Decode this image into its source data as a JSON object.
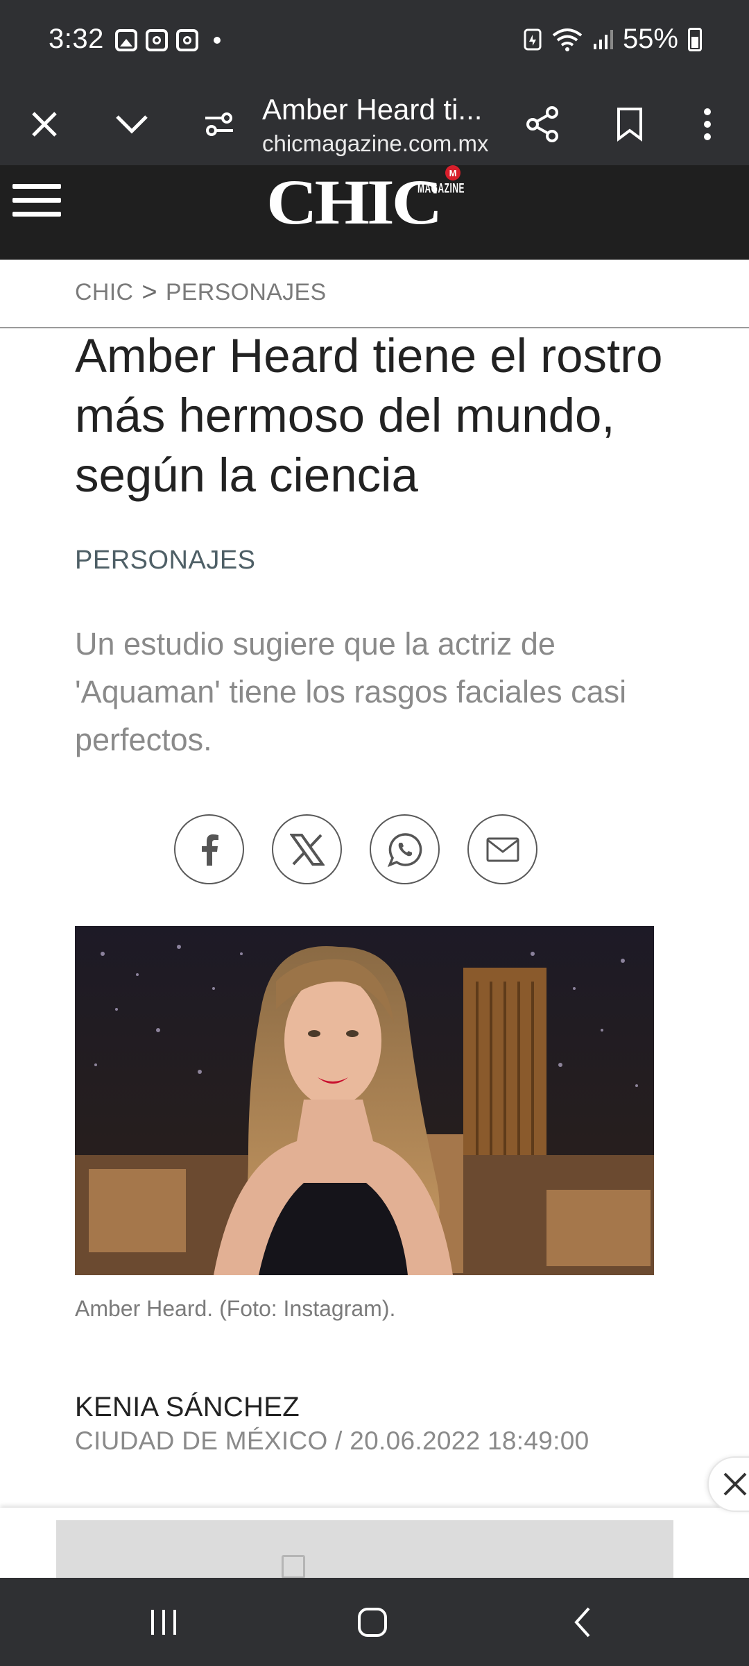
{
  "status": {
    "time": "3:32",
    "battery": "55%"
  },
  "browser": {
    "tab_title": "Amber Heard ti...",
    "url": "chicmagazine.com.mx"
  },
  "site": {
    "logo": "CHIC",
    "logo_sub": "MAGAZINE",
    "logo_badge": "M"
  },
  "breadcrumb": {
    "home": "CHIC",
    "separator": ">",
    "section": "PERSONAJES"
  },
  "article": {
    "headline": "Amber Heard tiene el rostro más hermoso del mundo, según la ciencia",
    "section": "PERSONAJES",
    "dek": "Un estudio sugiere que la actriz de 'Aquaman' tiene los rasgos faciales casi perfectos.",
    "caption": "Amber Heard. (Foto: Instagram).",
    "author": "KENIA SÁNCHEZ",
    "dateline": "CIUDAD DE MÉXICO / 20.06.2022 18:49:00"
  },
  "share": [
    {
      "icon": "facebook-icon"
    },
    {
      "icon": "x-icon"
    },
    {
      "icon": "whatsapp-icon"
    },
    {
      "icon": "email-icon"
    }
  ],
  "colors": {
    "chrome": "#2f3033",
    "header": "#1f1f1f",
    "badge": "#d81e2b",
    "section": "#4e5f66"
  }
}
